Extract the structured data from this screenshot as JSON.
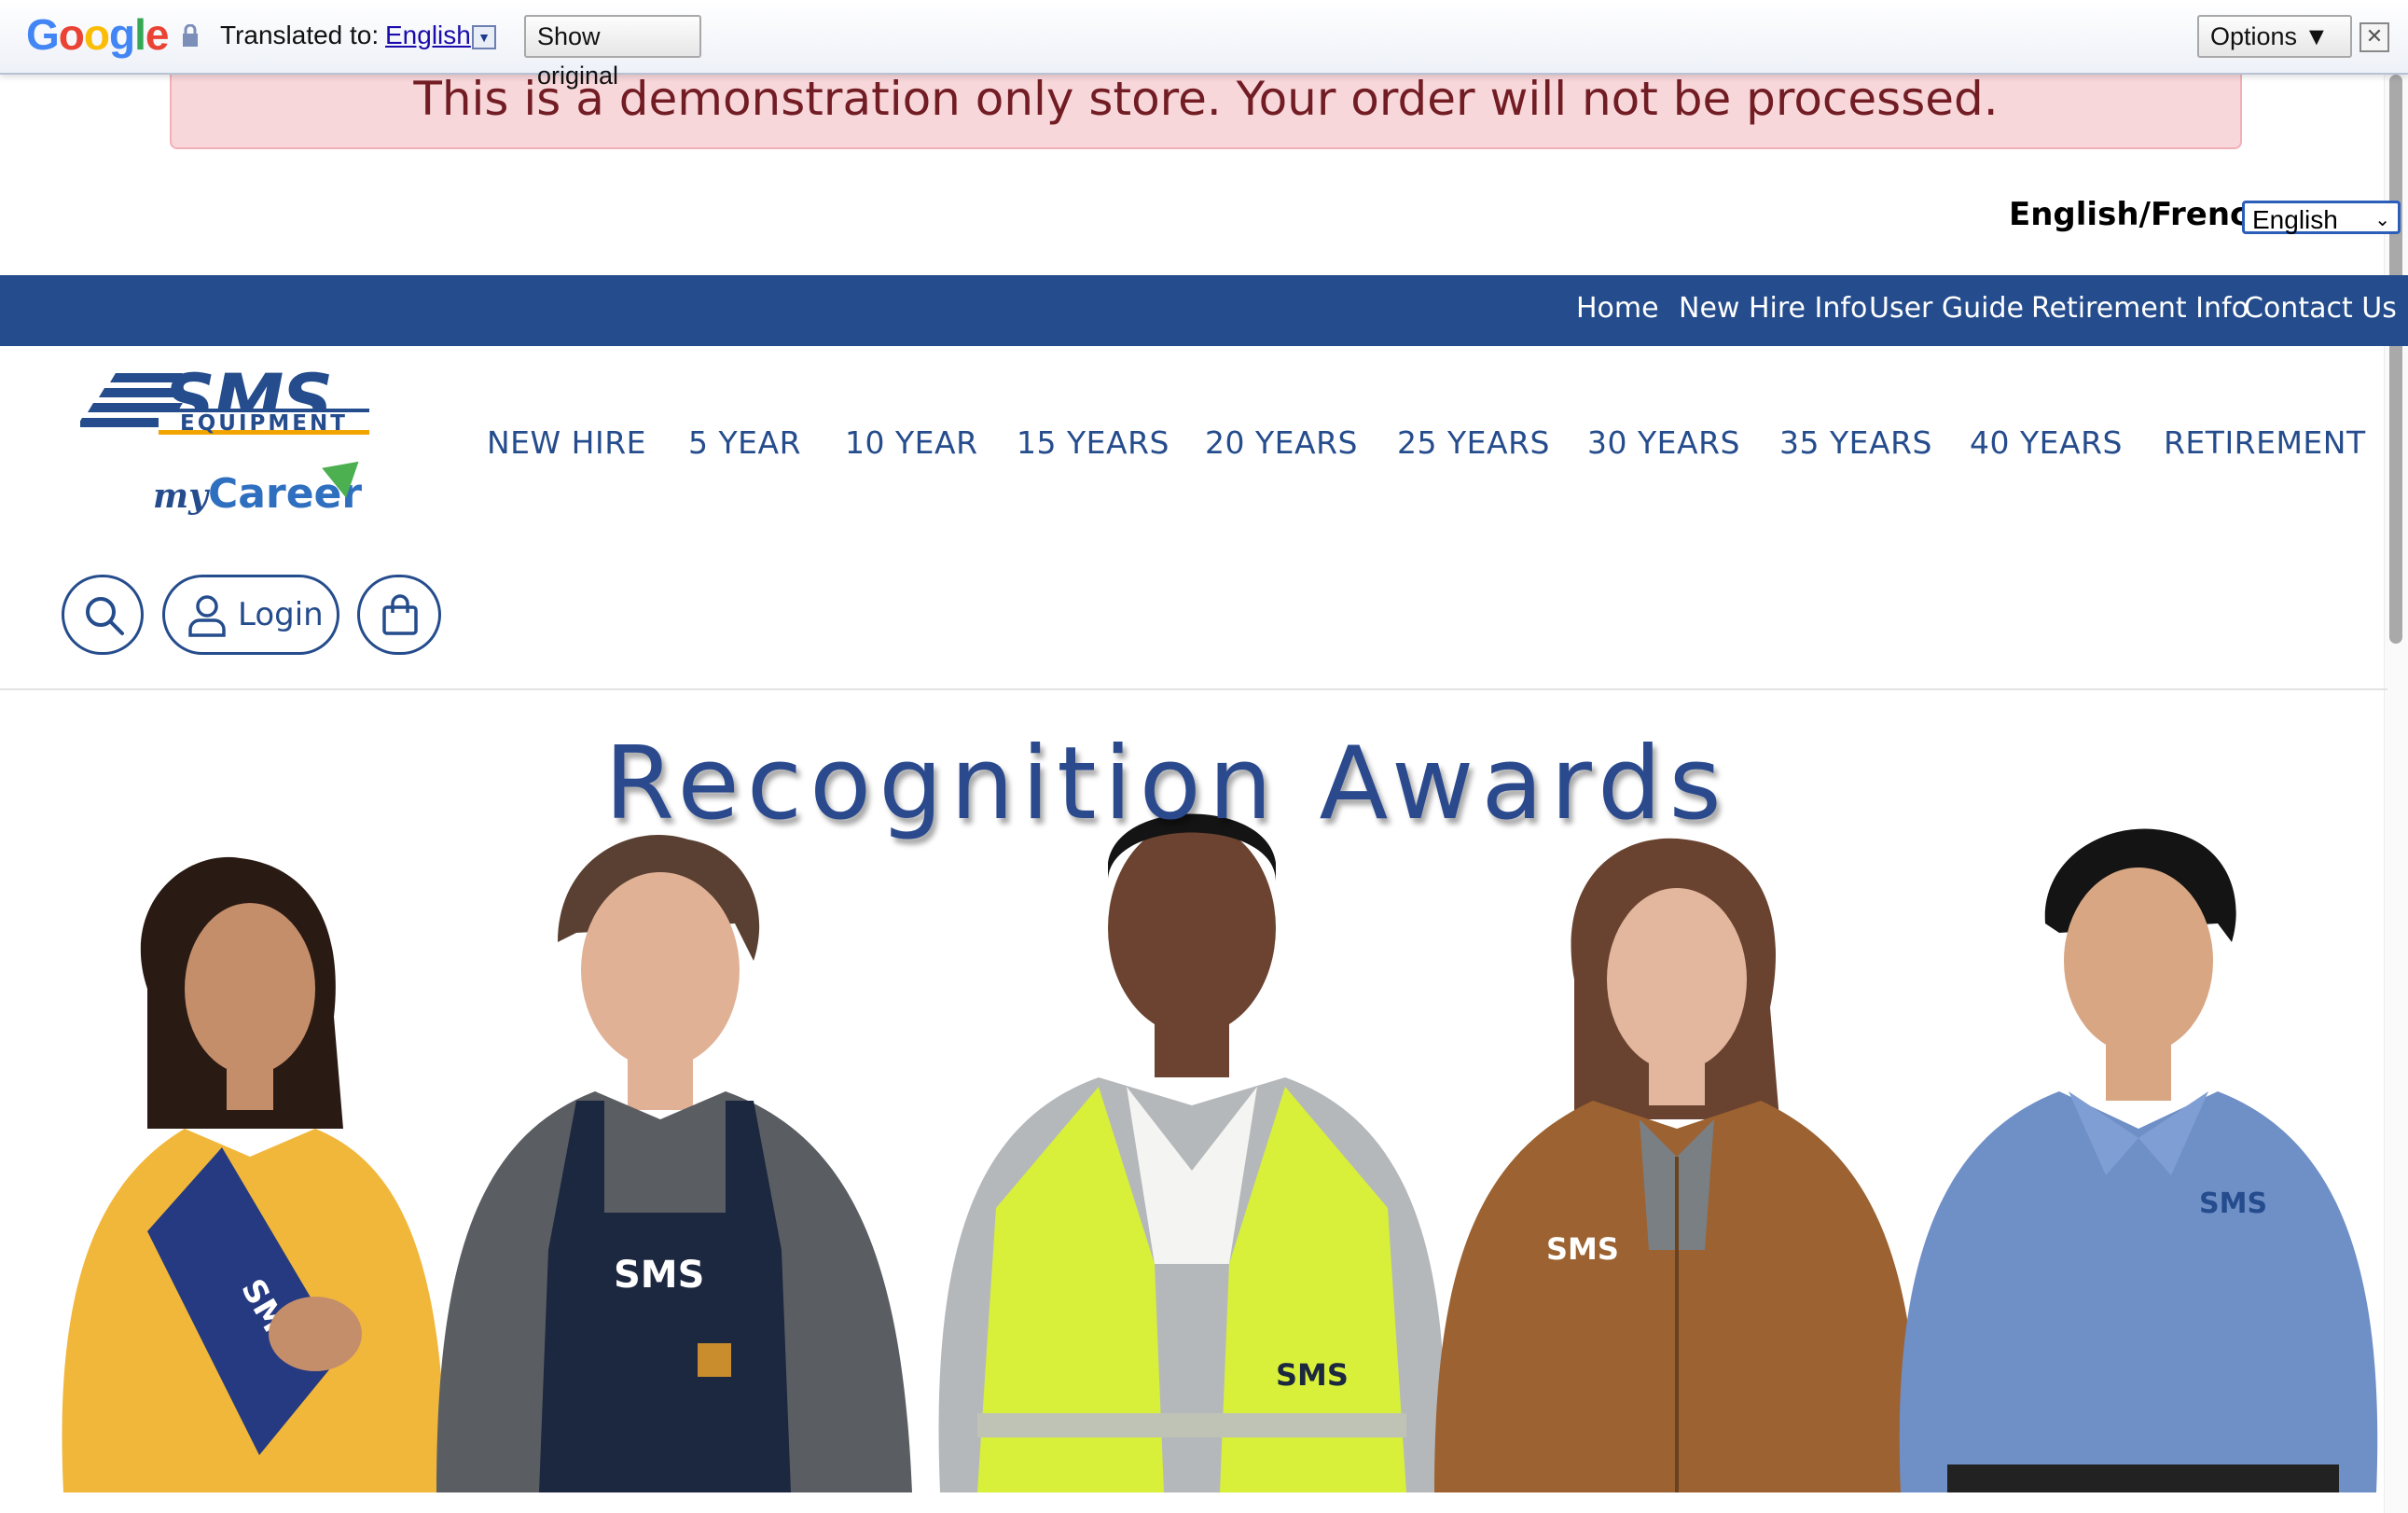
{
  "translate_bar": {
    "logo_text": [
      "G",
      "o",
      "o",
      "g",
      "l",
      "e"
    ],
    "translated_to_label": "Translated to:",
    "language": "English",
    "show_original": "Show original",
    "options": "Options ▼",
    "close": "✕"
  },
  "banner": {
    "message": "This is a demonstration only store. Your order will not be processed."
  },
  "language_selector": {
    "label": "English/French",
    "selected": "English"
  },
  "top_nav": {
    "items": [
      "Home",
      "New Hire Info",
      "User Guide",
      "Retirement Info",
      "Contact Us"
    ]
  },
  "logo": {
    "brand": "SMS",
    "sub": "EQUIPMENT",
    "my": "my",
    "career": "Career"
  },
  "main_nav": {
    "items": [
      "NEW HIRE",
      "5 YEAR",
      "10 YEAR",
      "15 YEARS",
      "20 YEARS",
      "25 YEARS",
      "30 YEARS",
      "35 YEARS",
      "40 YEARS",
      "RETIREMENT"
    ]
  },
  "actions": {
    "login": "Login"
  },
  "hero": {
    "title": "Recognition Awards",
    "shirt_logo": "SMS"
  },
  "colors": {
    "brand_blue": "#254c8c",
    "banner_bg": "#f8d7da",
    "banner_text": "#721c24"
  }
}
